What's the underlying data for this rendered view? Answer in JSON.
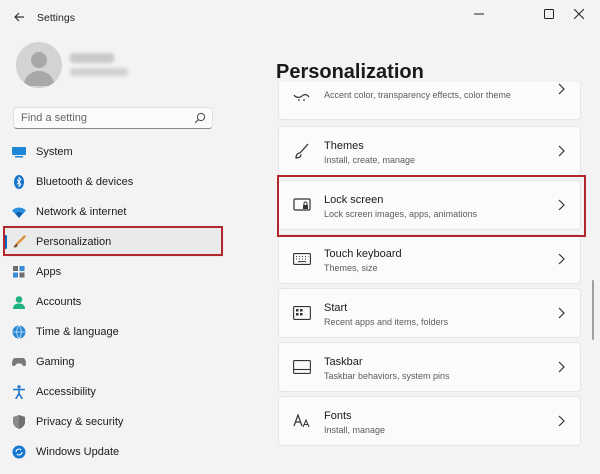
{
  "window": {
    "title": "Settings"
  },
  "search": {
    "placeholder": "Find a setting"
  },
  "nav": {
    "items": [
      {
        "label": "System"
      },
      {
        "label": "Bluetooth & devices"
      },
      {
        "label": "Network & internet"
      },
      {
        "label": "Personalization"
      },
      {
        "label": "Apps"
      },
      {
        "label": "Accounts"
      },
      {
        "label": "Time & language"
      },
      {
        "label": "Gaming"
      },
      {
        "label": "Accessibility"
      },
      {
        "label": "Privacy & security"
      },
      {
        "label": "Windows Update"
      }
    ],
    "selected": "Personalization"
  },
  "main": {
    "title": "Personalization",
    "cards": [
      {
        "title": "",
        "subtitle": "Accent color, transparency effects, color theme",
        "icon": "palette-icon"
      },
      {
        "title": "Themes",
        "subtitle": "Install, create, manage",
        "icon": "brush-icon"
      },
      {
        "title": "Lock screen",
        "subtitle": "Lock screen images, apps, animations",
        "icon": "lock-screen-icon"
      },
      {
        "title": "Touch keyboard",
        "subtitle": "Themes, size",
        "icon": "keyboard-icon"
      },
      {
        "title": "Start",
        "subtitle": "Recent apps and items, folders",
        "icon": "start-icon"
      },
      {
        "title": "Taskbar",
        "subtitle": "Taskbar behaviors, system pins",
        "icon": "taskbar-icon"
      },
      {
        "title": "Fonts",
        "subtitle": "Install, manage",
        "icon": "fonts-icon"
      }
    ]
  },
  "colors": {
    "accent": "#0067c0",
    "highlight": "#b3262b",
    "background": "#f3f3f3",
    "card": "#fbfbfb"
  }
}
